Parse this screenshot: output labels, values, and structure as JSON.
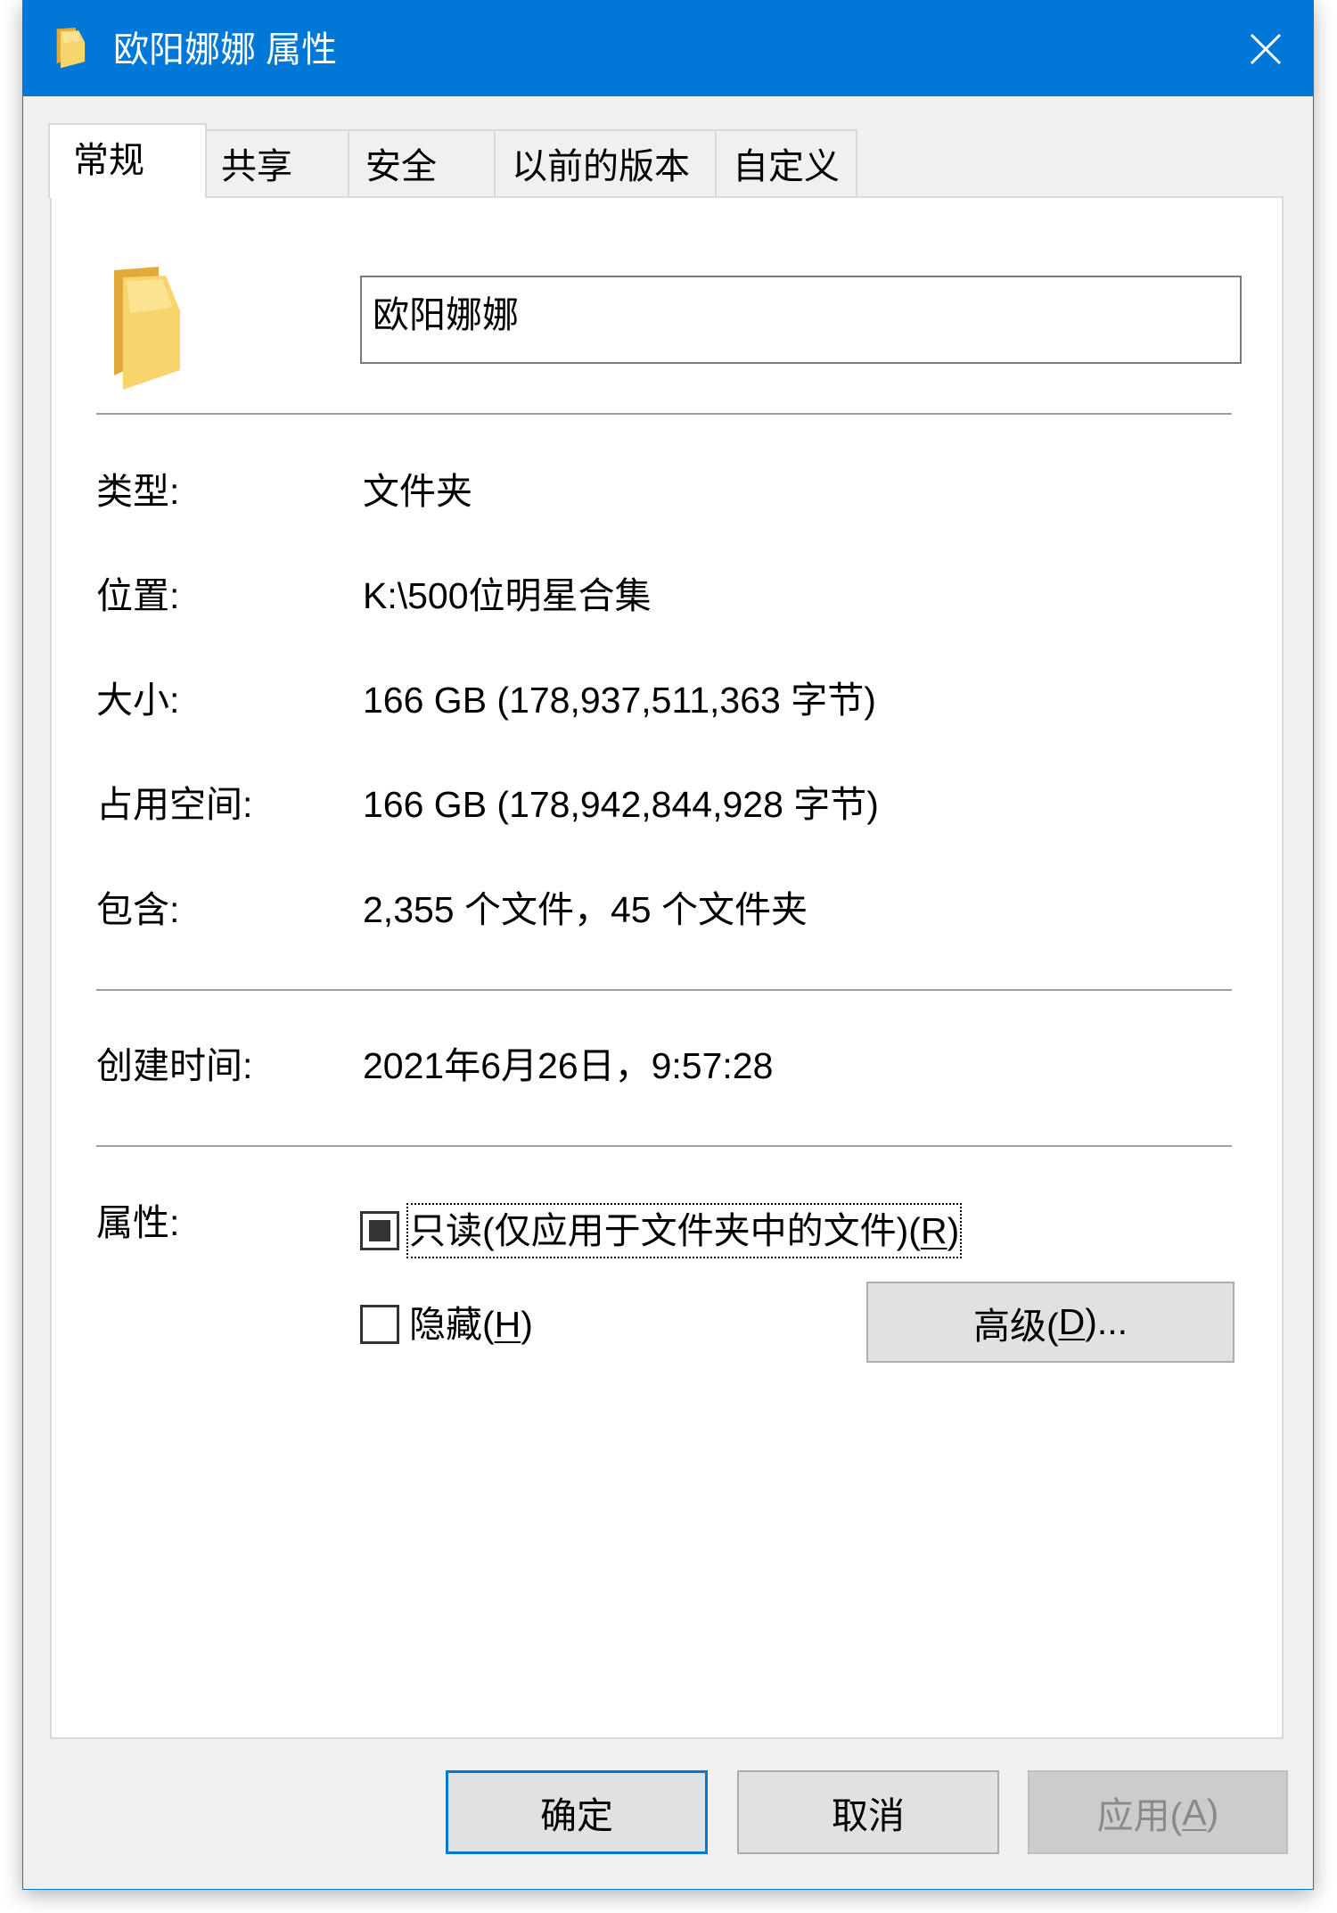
{
  "window": {
    "title": "欧阳娜娜 属性",
    "title_icon": "folder-icon",
    "close_icon": "close-icon"
  },
  "tabs": [
    {
      "label": "常规",
      "active": true
    },
    {
      "label": "共享",
      "active": false
    },
    {
      "label": "安全",
      "active": false
    },
    {
      "label": "以前的版本",
      "active": false
    },
    {
      "label": "自定义",
      "active": false
    }
  ],
  "general": {
    "folder_icon": "folder-icon",
    "name": "欧阳娜娜",
    "rows": [
      {
        "label": "类型:",
        "value": "文件夹"
      },
      {
        "label": "位置:",
        "value": "K:\\500位明星合集"
      },
      {
        "label": "大小:",
        "value": "166 GB (178,937,511,363 字节)"
      },
      {
        "label": "占用空间:",
        "value": "166 GB (178,942,844,928 字节)"
      },
      {
        "label": "包含:",
        "value": "2,355 个文件，45 个文件夹"
      }
    ],
    "created": {
      "label": "创建时间:",
      "value": "2021年6月26日，9:57:28"
    }
  },
  "attributes": {
    "label": "属性:",
    "readonly": {
      "text": "只读(仅应用于文件夹中的文件)(",
      "access_key": "R",
      "suffix": ")",
      "checked": false,
      "indeterminate": true,
      "focused": true
    },
    "hidden": {
      "text": "隐藏(",
      "access_key": "H",
      "suffix": ")",
      "checked": false,
      "indeterminate": false,
      "focused": false
    },
    "advanced": {
      "text": "高级(",
      "access_key": "D",
      "suffix": ")..."
    }
  },
  "footer": {
    "ok": {
      "label": "确定",
      "default": true,
      "enabled": true
    },
    "cancel": {
      "label": "取消",
      "default": false,
      "enabled": true
    },
    "apply": {
      "text": "应用(",
      "access_key": "A",
      "suffix": ")",
      "default": false,
      "enabled": false
    }
  },
  "colors": {
    "title_bar": "#0078d7",
    "default_button_border": "#0078d7",
    "folder_back": "#e2a93b",
    "folder_front": "#f8d46c",
    "folder_highlight": "#fde8a4"
  }
}
